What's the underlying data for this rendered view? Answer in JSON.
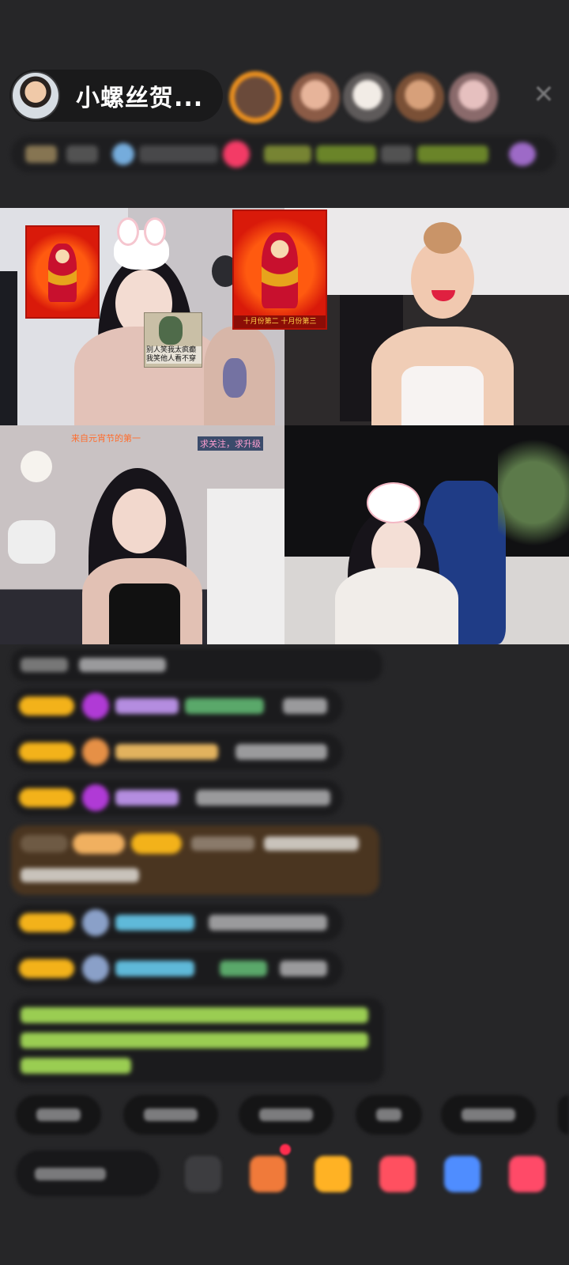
{
  "header": {
    "host_name": "小螺丝贺...",
    "close_symbol": "✕",
    "viewers": [
      {
        "color": "#e98f1f"
      },
      {
        "color": "#d8a084"
      },
      {
        "color": "#e8e2dc"
      },
      {
        "color": "#b77a55"
      },
      {
        "color": "#c9a2a3"
      }
    ]
  },
  "video_grid": {
    "cells": [
      {
        "name": "stream-top-left"
      },
      {
        "name": "stream-top-right"
      },
      {
        "name": "stream-bottom-left",
        "label": "求关注，求升级",
        "label_top": "来自元宵节的第一"
      },
      {
        "name": "stream-bottom-right"
      }
    ],
    "sticker_caption_1": "别人笑我太疯癫 我笑他人看不穿",
    "sticker_caption_2": "十月份第二 十月份第三"
  },
  "chat": {
    "rows": [
      {
        "badge_color": "#f3b21a",
        "icon_color": "#b03ad6",
        "name_color": "#b48de0"
      },
      {
        "badge_color": "#f3b21a",
        "icon_color": "#e69046",
        "name_color": "#e2b25e"
      },
      {
        "badge_color": "#f3b21a",
        "icon_color": "#b03ad6",
        "name_color": "#b48de0"
      },
      {
        "badge_color": "#f3b21a",
        "icon_color": "#8aa0c8",
        "name_color": "#5fb9d9"
      },
      {
        "badge_color": "#f3b21a",
        "icon_color": "#8aa0c8",
        "name_color": "#5fb9d9"
      }
    ],
    "colors": {
      "system_msg_text": "#9acd52",
      "highlight_msg_bg": "#4a3520"
    }
  },
  "toolbar": {
    "tool_colors": [
      "#3d3d40",
      "#f07a3a",
      "#ffb224",
      "#ff5060",
      "#4f8dff",
      "#ff4a68"
    ]
  }
}
